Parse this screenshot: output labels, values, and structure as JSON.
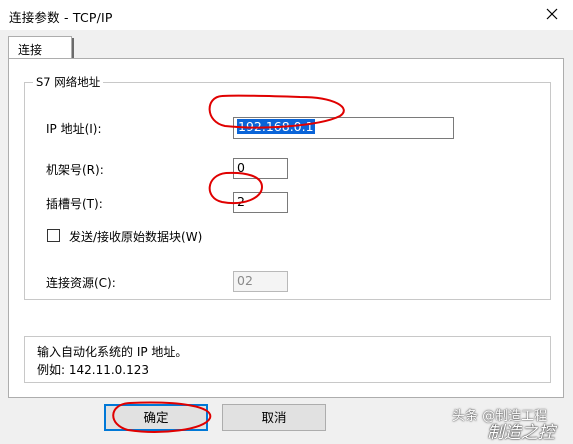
{
  "window": {
    "title": "连接参数 - TCP/IP"
  },
  "tabs": [
    {
      "label": "连接"
    }
  ],
  "network": {
    "group_title": "S7 网络地址",
    "ip_label": "IP 地址(I):",
    "ip_value": "192.168.0.1",
    "rack_label": "机架号(R):",
    "rack_value": "0",
    "slot_label": "插槽号(T):",
    "slot_value": "2",
    "raw_block_label": "发送/接收原始数据块(W)",
    "raw_block_checked": false,
    "resource_label": "连接资源(C):",
    "resource_value": "02"
  },
  "info": {
    "line1": "输入自动化系统的 IP 地址。",
    "line2": "例如: 142.11.0.123"
  },
  "buttons": {
    "ok": "确定",
    "cancel": "取消"
  },
  "watermark": {
    "line1": "头条 @制造工程",
    "line2": "制造之控"
  },
  "colors": {
    "selection": "#0a64d8",
    "annotation": "#e00000",
    "default_button_border": "#0078d7"
  }
}
